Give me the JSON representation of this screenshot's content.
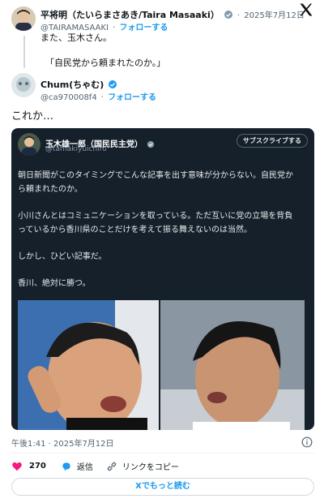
{
  "author": {
    "name": "平将明（たいらまさあき/Taira Masaaki）",
    "date": "2025年7月12日",
    "handle": "@TAIRAMASAAKI",
    "follow": "フォローする",
    "text_line1": "また、玉木さん。",
    "text_line2": "「自民党から頼まれたのか。」"
  },
  "quoted": {
    "name": "Chum(ちゃむ)",
    "handle": "@ca970008f4",
    "follow": "フォローする",
    "text": "これか…"
  },
  "embed": {
    "name": "玉木雄一郎（国民民主党）",
    "handle": "@tamakiyuichiro",
    "subscribe": "サブスクライブする",
    "paragraphs": {
      "p1a": "朝日新聞がこのタイミングでこんな記事を出す意味が分からない。自民党か",
      "p1b": "ら頼まれたのか。",
      "p2a": "小川さんとはコミュニケーションを取っている。ただ互いに党の立場を背負",
      "p2b": "っているから香川県のことだけを考えて振る舞えないのは当然。",
      "p3": "しかし、ひどい記事だ。",
      "p4": "香川、絶対に勝つ。"
    }
  },
  "timestamp": "午後1:41 · 2025年7月12日",
  "actions": {
    "likes": "270",
    "reply": "返信",
    "copy_link": "リンクをコピー"
  },
  "read_more": "Xでもっと読む",
  "sep_dot": "·",
  "colors": {
    "accent": "#1d9bf0",
    "like": "#f91880",
    "dark_embed": "#15202b"
  },
  "icons": [
    "verified-badge-icon",
    "x-logo-icon",
    "info-icon",
    "heart-icon",
    "reply-icon",
    "link-icon"
  ]
}
